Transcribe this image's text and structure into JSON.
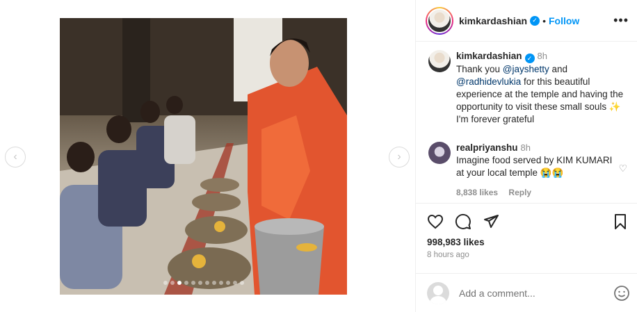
{
  "post": {
    "carousel_dots": 12,
    "active_dot": 2
  },
  "header": {
    "username": "kimkardashian",
    "separator": "•",
    "follow_label": "Follow",
    "more_label": "•••"
  },
  "caption": {
    "username": "kimkardashian",
    "time": "8h",
    "text_parts": {
      "p1": "Thank you ",
      "mention1": "@jayshetty",
      "p2": " and ",
      "mention2": "@radhidevlukia",
      "p3": " for this beautiful experience at the temple and having the opportunity to visit these small souls ",
      "emoji": "✨",
      "p4": " I'm forever grateful"
    }
  },
  "comment": {
    "username": "realpriyanshu",
    "time": "8h",
    "text": "Imagine food served by KIM KUMARI at your local temple 😭😭",
    "likes": "8,838 likes",
    "reply_label": "Reply"
  },
  "engagement": {
    "likes": "998,983 likes",
    "time_ago": "8 hours ago"
  },
  "add_comment": {
    "placeholder": "Add a comment..."
  },
  "colors": {
    "accent": "#0095f6",
    "mention": "#00376b",
    "muted": "#8e8e8e"
  }
}
